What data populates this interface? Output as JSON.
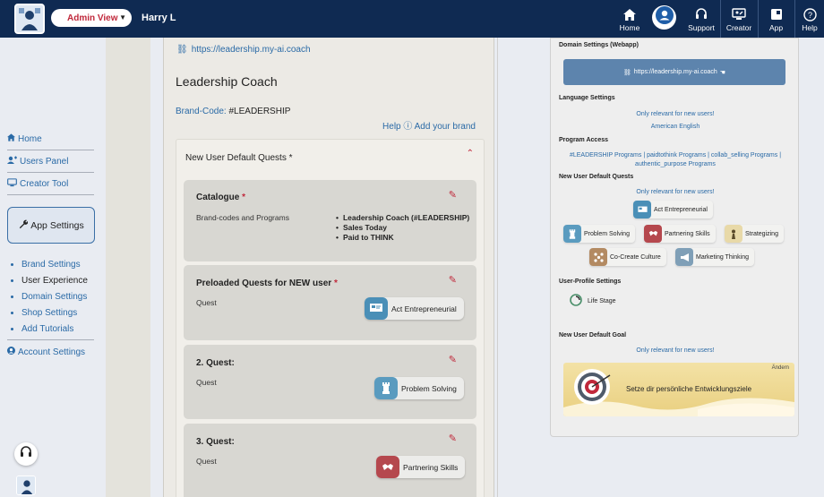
{
  "topbar": {
    "view_select": "Admin View",
    "user_name": "Harry L",
    "nav": [
      {
        "label": "Home",
        "icon": "home-icon"
      },
      {
        "label": "Support",
        "icon": "headset-icon"
      },
      {
        "label": "Creator",
        "icon": "creator-icon"
      },
      {
        "label": "App",
        "icon": "app-icon"
      },
      {
        "label": "Help",
        "icon": "help-icon"
      }
    ]
  },
  "sidebar": {
    "items": [
      {
        "label": "Home",
        "icon": "home-icon"
      },
      {
        "label": "Users Panel",
        "icon": "users-icon"
      },
      {
        "label": "Creator Tool",
        "icon": "creator-icon"
      }
    ],
    "app_settings": "App Settings",
    "sub_items": [
      "Brand Settings",
      "User Experience",
      "Domain Settings",
      "Shop Settings",
      "Add Tutorials"
    ],
    "account_settings": "Account Settings"
  },
  "main": {
    "url": "https://leadership.my-ai.coach",
    "title": "Leadership Coach",
    "brand_code_label": "Brand-Code:",
    "brand_code": "#LEADERSHIP",
    "help_link": "Help ⓘ Add your brand",
    "panel_title": "New User Default Quests *",
    "catalogue": {
      "title": "Catalogue",
      "label": "Brand-codes and Programs",
      "programs": [
        "Leadership Coach (#LEADERSHIP)",
        "Sales Today",
        "Paid to THINK"
      ]
    },
    "preloaded": {
      "title": "Preloaded Quests for NEW user",
      "label": "Quest",
      "chip": "Act Entrepreneurial"
    },
    "quest2": {
      "title": "2. Quest:",
      "label": "Quest",
      "chip": "Problem Solving"
    },
    "quest3": {
      "title": "3. Quest:",
      "label": "Quest",
      "chip": "Partnering Skills"
    }
  },
  "preview": {
    "domain_label": "Domain Settings (Webapp)",
    "domain_button": "https://leadership.my-ai.coach",
    "language_label": "Language Settings",
    "language_note": "Only relevant for new users!",
    "language_value": "American English",
    "program_label": "Program Access",
    "program_value_1": "#LEADERSHIP Programs | paidtothink Programs | collab_selling Programs |",
    "program_value_2": "authentic_purpose Programs",
    "quests_label": "New User Default Quests",
    "quests_note": "Only relevant for new users!",
    "quests": [
      "Act Entrepreneurial",
      "Problem Solving",
      "Partnering Skills",
      "Strategizing",
      "Co-Create Culture",
      "Marketing Thinking"
    ],
    "profile_label": "User-Profile Settings",
    "life_stage": "Life Stage",
    "goal_label": "New User Default Goal",
    "goal_note": "Only relevant for new users!",
    "goal_text": "Setze dir persönliche Entwicklungsziele",
    "goal_change": "Ändern"
  },
  "colors": {
    "topbar": "#0f2a52",
    "accent_red": "#c0283b",
    "link_blue": "#2a6aa6",
    "domain_button": "#5d84ad"
  }
}
